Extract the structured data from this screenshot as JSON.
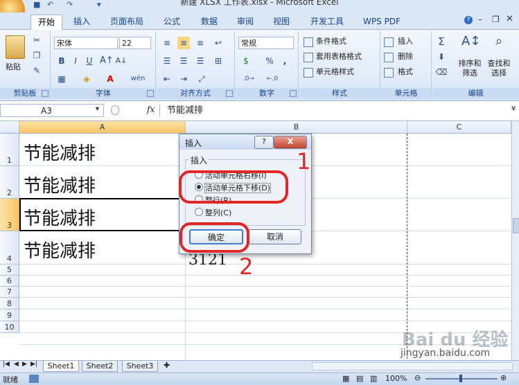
{
  "window": {
    "title": "新建 XLSX 工作表.xlsx - Microsoft Excel"
  },
  "ribbon": {
    "tabs": [
      "开始",
      "插入",
      "页面布局",
      "公式",
      "数据",
      "审阅",
      "视图",
      "开发工具",
      "WPS PDF"
    ],
    "paste_label": "粘贴",
    "font_name": "宋体",
    "font_size": "22",
    "bold": "B",
    "italic": "I",
    "underline": "U",
    "number_format": "常规",
    "percent": "%",
    "comma": ",",
    "conditional_format": "条件格式",
    "table_format": "套用表格格式",
    "cell_style": "单元格样式",
    "insert": "插入",
    "delete": "删除",
    "format": "格式",
    "sort_filter": "排序和筛选",
    "find_select": "查找和选择",
    "groups": [
      "剪贴板",
      "字体",
      "对齐方式",
      "数字",
      "样式",
      "单元格",
      "编辑"
    ]
  },
  "formula_bar": {
    "name_box": "A3",
    "fx": "fx",
    "content": "节能减排"
  },
  "grid": {
    "columns": [
      "A",
      "B",
      "C"
    ],
    "rows": [
      "1",
      "2",
      "3",
      "4",
      "5",
      "6",
      "7",
      "8",
      "9",
      "10"
    ],
    "cells": [
      "节能减排",
      "节能减排",
      "节能减排",
      "节能减排"
    ],
    "b4": "3121"
  },
  "sheets": [
    "Sheet1",
    "Sheet2",
    "Sheet3"
  ],
  "status": {
    "ready": "就绪",
    "zoom": "100%"
  },
  "dialog": {
    "title": "插入",
    "help": "?",
    "close": "X",
    "group_label": "插入",
    "options": [
      "活动单元格右移(I)",
      "活动单元格下移(D)",
      "整行(R)",
      "整列(C)"
    ],
    "ok": "确定",
    "cancel": "取消"
  },
  "annotations": {
    "step1": "1",
    "step2": "2"
  },
  "watermark": {
    "brand": "Bai du 经验",
    "url": "jingyan.baidu.com"
  },
  "colors": {
    "annotation": "#e02626",
    "ribbon": "#dbe7f5",
    "selection_header": "#f6c466"
  }
}
